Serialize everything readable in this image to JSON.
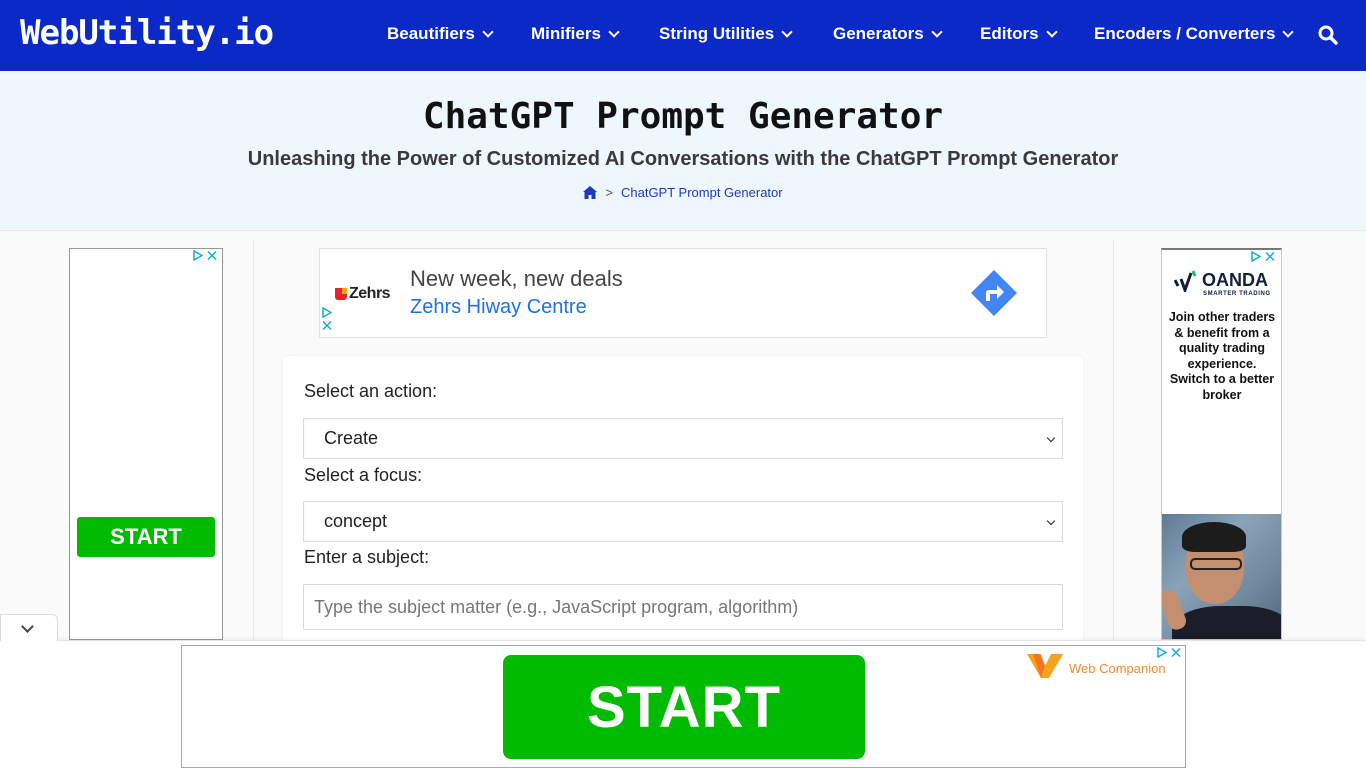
{
  "header": {
    "logo": "WebUtility.io",
    "nav": [
      {
        "label": "Beautifiers",
        "icon": "chevron-down-icon"
      },
      {
        "label": "Minifiers",
        "icon": "chevron-down-icon"
      },
      {
        "label": "String Utilities",
        "icon": "chevron-down-icon"
      },
      {
        "label": "Generators",
        "icon": "chevron-down-icon"
      },
      {
        "label": "Editors",
        "icon": "chevron-down-icon"
      },
      {
        "label": "Encoders / Converters",
        "icon": "chevron-down-icon"
      }
    ],
    "search_icon": "search-icon"
  },
  "hero": {
    "title": "ChatGPT Prompt Generator",
    "subtitle": "Unleashing the Power of Customized AI Conversations with the ChatGPT Prompt Generator",
    "breadcrumb": {
      "home_icon": "home-icon",
      "separator": ">",
      "current": "ChatGPT Prompt Generator"
    }
  },
  "form": {
    "action_label": "Select an action:",
    "action_value": "Create",
    "focus_label": "Select a focus:",
    "focus_value": "concept",
    "subject_label": "Enter a subject:",
    "subject_value": "",
    "subject_placeholder": "Type the subject matter (e.g., JavaScript program, algorithm)"
  },
  "ads": {
    "top_banner": {
      "brand": "Zehrs",
      "headline": "New week, new deals",
      "link": "Zehrs Hiway Centre",
      "icon": "directions-icon"
    },
    "left_skyscraper": {
      "button": "START"
    },
    "right_skyscraper": {
      "brand": "OANDA",
      "tagline": "SMARTER TRADING",
      "copy": "Join other traders & benefit from a quality trading experience. Switch to a better broker"
    },
    "bottom_sticky": {
      "button": "START",
      "brand": "Web Companion"
    }
  },
  "colors": {
    "nav_bg": "#0b29c6",
    "hero_bg": "#eef6fe",
    "link": "#1b3bb8",
    "start_green": "#00bb00",
    "adchoices": "#1aa9d6"
  }
}
